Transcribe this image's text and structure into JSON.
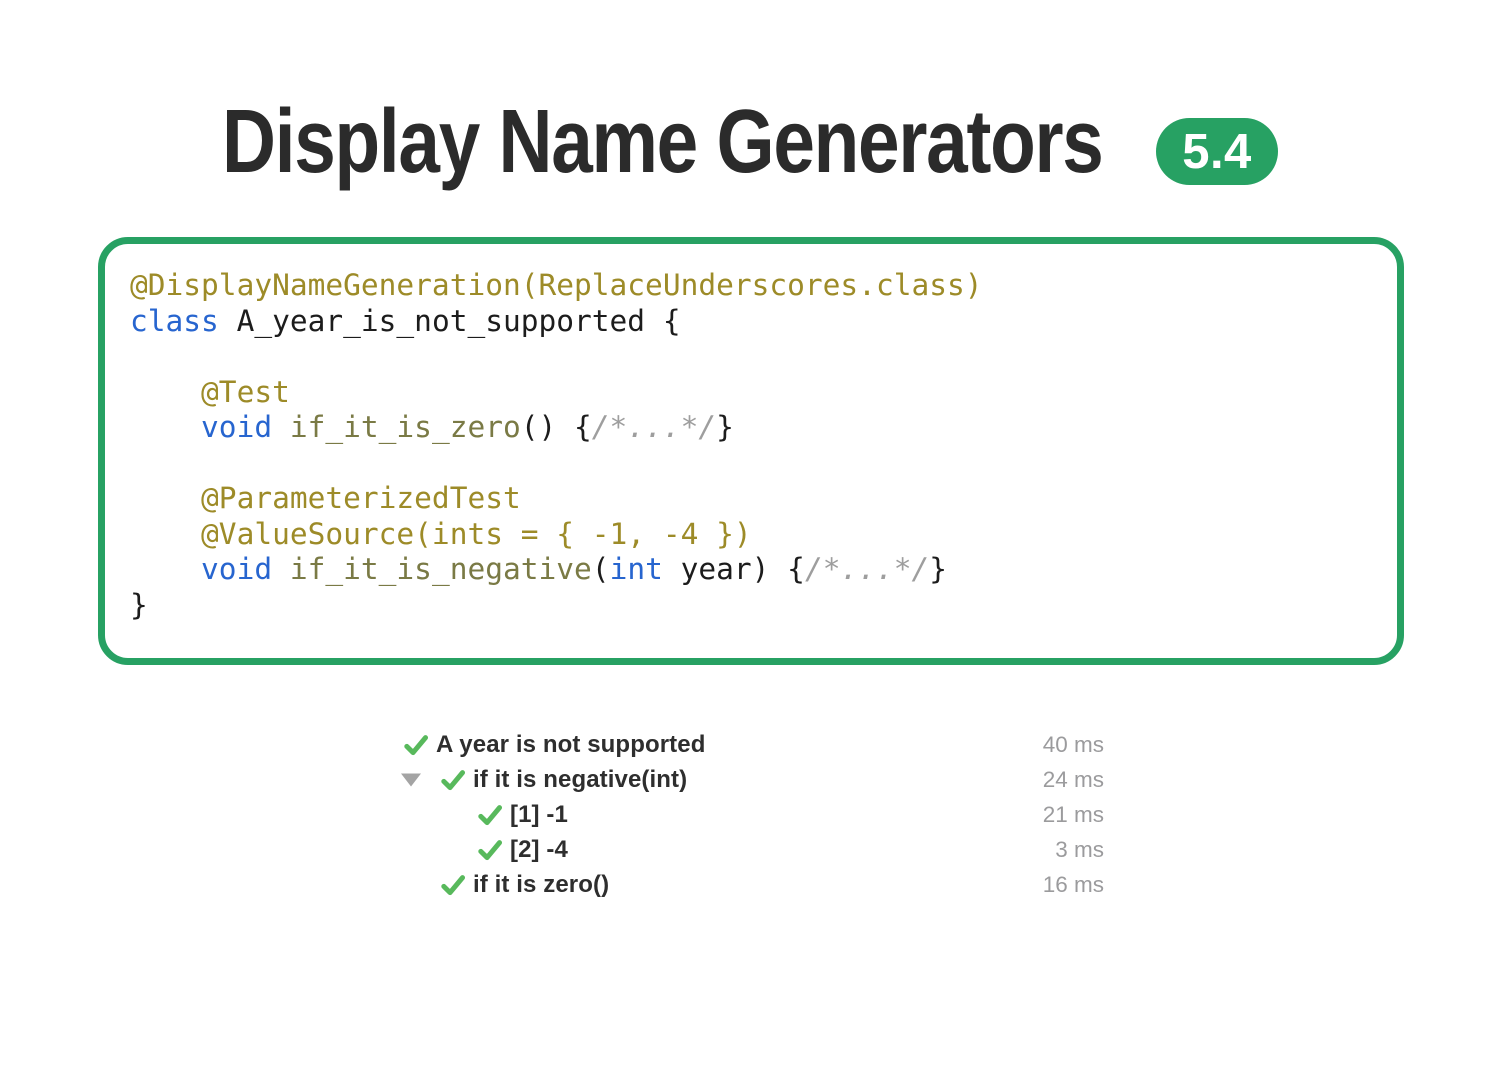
{
  "colors": {
    "accent_green": "#27a163",
    "check_green": "#58b95c",
    "expander_gray": "#a4a4a4",
    "title_color": "#2b2b2b",
    "label_color": "#2e2e2e",
    "time_color": "#9b9b9d",
    "code_plain": "#1c1c1c",
    "code_annotation": "#9d8b28",
    "code_keyword": "#2765cf",
    "code_method": "#7a7a45",
    "code_comment": "#9e9e9e"
  },
  "header": {
    "title": "Display Name Generators",
    "version_badge": "5.4"
  },
  "code_panel": {
    "lines": [
      [
        [
          "annotation",
          "@DisplayNameGeneration(ReplaceUnderscores.class)"
        ]
      ],
      [
        [
          "keyword",
          "class"
        ],
        [
          "plain",
          " A_year_is_not_supported {"
        ]
      ],
      [],
      [
        [
          "plain",
          "    "
        ],
        [
          "annotation",
          "@Test"
        ]
      ],
      [
        [
          "plain",
          "    "
        ],
        [
          "keyword",
          "void"
        ],
        [
          "plain",
          " "
        ],
        [
          "method",
          "if_it_is_zero"
        ],
        [
          "plain",
          "() {"
        ],
        [
          "comment",
          "/*...*/"
        ],
        [
          "plain",
          "}"
        ]
      ],
      [],
      [
        [
          "plain",
          "    "
        ],
        [
          "annotation",
          "@ParameterizedTest"
        ]
      ],
      [
        [
          "plain",
          "    "
        ],
        [
          "annotation",
          "@ValueSource(ints = { -1, -4 })"
        ]
      ],
      [
        [
          "plain",
          "    "
        ],
        [
          "keyword",
          "void"
        ],
        [
          "plain",
          " "
        ],
        [
          "method",
          "if_it_is_negative"
        ],
        [
          "plain",
          "("
        ],
        [
          "keyword",
          "int"
        ],
        [
          "plain",
          " year) {"
        ],
        [
          "comment",
          "/*...*/"
        ],
        [
          "plain",
          "}"
        ]
      ],
      [
        [
          "plain",
          "}"
        ]
      ]
    ]
  },
  "test_results": {
    "rows": [
      {
        "status": "passed",
        "has_expander": false,
        "indent": 0,
        "label": "A year is not supported",
        "time": "40 ms"
      },
      {
        "status": "passed",
        "has_expander": true,
        "indent": 1,
        "label": "if it is negative(int)",
        "time": "24 ms"
      },
      {
        "status": "passed",
        "has_expander": false,
        "indent": 2,
        "label": "[1] -1",
        "time": "21 ms"
      },
      {
        "status": "passed",
        "has_expander": false,
        "indent": 2,
        "label": "[2] -4",
        "time": "3 ms"
      },
      {
        "status": "passed",
        "has_expander": false,
        "indent": 1,
        "label": "if it is zero()",
        "time": "16 ms"
      }
    ]
  }
}
